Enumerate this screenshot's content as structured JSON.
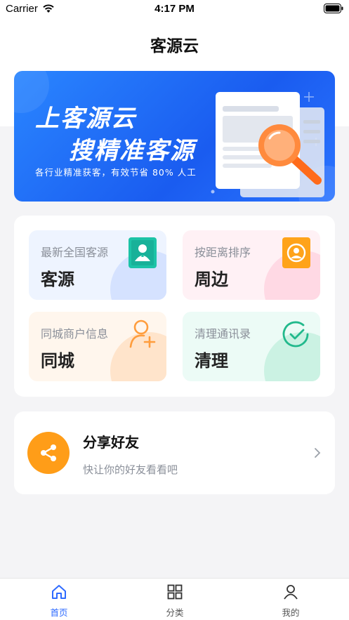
{
  "status_bar": {
    "carrier": "Carrier",
    "time": "4:17 PM"
  },
  "header": {
    "title": "客源云"
  },
  "banner": {
    "line1": "上客源云",
    "line2": "搜精准客源",
    "subtitle": "各行业精准获客，有效节省 80% 人工"
  },
  "features": [
    {
      "sub": "最新全国客源",
      "main": "客源",
      "icon": "person-badge-icon"
    },
    {
      "sub": "按距离排序",
      "main": "周边",
      "icon": "nearby-user-icon"
    },
    {
      "sub": "同城商户信息",
      "main": "同城",
      "icon": "add-user-icon"
    },
    {
      "sub": "清理通讯录",
      "main": "清理",
      "icon": "check-circle-icon"
    }
  ],
  "share": {
    "title": "分享好友",
    "subtitle": "快让你的好友看看吧"
  },
  "tabs": [
    {
      "label": "首页",
      "icon": "home-icon",
      "active": true
    },
    {
      "label": "分类",
      "icon": "grid-icon",
      "active": false
    },
    {
      "label": "我的",
      "icon": "user-icon",
      "active": false
    }
  ],
  "colors": {
    "accent": "#2f6bff",
    "share_orange": "#ff9d18",
    "tile_icon_teal": "#1cc3a7",
    "tile_icon_orange": "#ffa31a",
    "banner_blue": "#1a5cf0"
  }
}
